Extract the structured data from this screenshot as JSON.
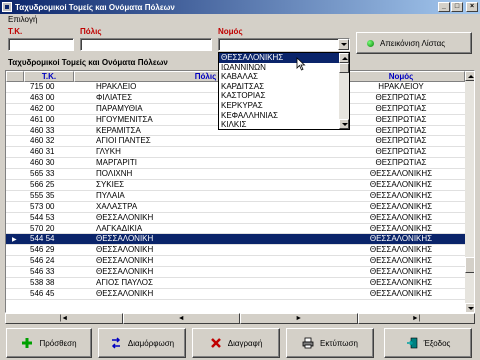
{
  "window": {
    "title": "Ταχυδρομικοί Τομείς και Ονόματα Πόλεων",
    "minimize": "_",
    "maximize": "□",
    "close": "×"
  },
  "selection": {
    "group_label": "Επιλογή",
    "tk_label": "Τ.Κ.",
    "city_label": "Πόλις",
    "nomos_label": "Νομός",
    "tk_value": "",
    "city_value": "",
    "nomos_value": "",
    "show_all_label": "Απεικόνιση Λίστας"
  },
  "dropdown": {
    "options": [
      "ΘΕΣΣΑΛΟΝΙΚΗΣ",
      "ΙΩΑΝΝΙΝΩΝ",
      "ΚΑΒΑΛΑΣ",
      "ΚΑΡΔΙΤΣΑΣ",
      "ΚΑΣΤΟΡΙΑΣ",
      "ΚΕΡΚΥΡΑΣ",
      "ΚΕΦΑΛΛΗΝΙΑΣ",
      "ΚΙΛΚΙΣ"
    ],
    "highlighted": 0
  },
  "grid": {
    "title": "Ταχυδρομικοί Τομείς και Ονόματα Πόλεων",
    "headers": {
      "tk": "Τ.Κ.",
      "city": "Πόλις",
      "nomos": "Νομός"
    },
    "rows": [
      {
        "tk": "715 00",
        "city": "ΗΡΑΚΛΕΙΟ",
        "nomos": "ΗΡΑΚΛΕΙΟΥ"
      },
      {
        "tk": "463 00",
        "city": "ΦΙΛΙΑΤΕΣ",
        "nomos": "ΘΕΣΠΡΩΤΙΑΣ"
      },
      {
        "tk": "462 00",
        "city": "ΠΑΡΑΜΥΘΙΑ",
        "nomos": "ΘΕΣΠΡΩΤΙΑΣ"
      },
      {
        "tk": "461 00",
        "city": "ΗΓΟΥΜΕΝΙΤΣΑ",
        "nomos": "ΘΕΣΠΡΩΤΙΑΣ"
      },
      {
        "tk": "460 33",
        "city": "ΚΕΡΑΜΙΤΣΑ",
        "nomos": "ΘΕΣΠΡΩΤΙΑΣ"
      },
      {
        "tk": "460 32",
        "city": "ΑΓΙΟΙ ΠΑΝΤΕΣ",
        "nomos": "ΘΕΣΠΡΩΤΙΑΣ"
      },
      {
        "tk": "460 31",
        "city": "ΓΛΥΚΗ",
        "nomos": "ΘΕΣΠΡΩΤΙΑΣ"
      },
      {
        "tk": "460 30",
        "city": "ΜΑΡΓΑΡΙΤΙ",
        "nomos": "ΘΕΣΠΡΩΤΙΑΣ"
      },
      {
        "tk": "565 33",
        "city": "ΠΟΛΙΧΝΗ",
        "nomos": "ΘΕΣΣΑΛΟΝΙΚΗΣ"
      },
      {
        "tk": "566 25",
        "city": "ΣΥΚΙΕΣ",
        "nomos": "ΘΕΣΣΑΛΟΝΙΚΗΣ"
      },
      {
        "tk": "555 35",
        "city": "ΠΥΛΑΙΑ",
        "nomos": "ΘΕΣΣΑΛΟΝΙΚΗΣ"
      },
      {
        "tk": "573 00",
        "city": "ΧΑΛΑΣΤΡΑ",
        "nomos": "ΘΕΣΣΑΛΟΝΙΚΗΣ"
      },
      {
        "tk": "544 53",
        "city": "ΘΕΣΣΑΛΟΝΙΚΗ",
        "nomos": "ΘΕΣΣΑΛΟΝΙΚΗΣ"
      },
      {
        "tk": "570 20",
        "city": "ΛΑΓΚΑΔΙΚΙΑ",
        "nomos": "ΘΕΣΣΑΛΟΝΙΚΗΣ"
      },
      {
        "tk": "544 54",
        "city": "ΘΕΣΣΑΛΟΝΙΚΗ",
        "nomos": "ΘΕΣΣΑΛΟΝΙΚΗΣ"
      },
      {
        "tk": "546 29",
        "city": "ΘΕΣΣΑΛΟΝΙΚΗ",
        "nomos": "ΘΕΣΣΑΛΟΝΙΚΗΣ"
      },
      {
        "tk": "546 24",
        "city": "ΘΕΣΣΑΛΟΝΙΚΗ",
        "nomos": "ΘΕΣΣΑΛΟΝΙΚΗΣ"
      },
      {
        "tk": "546 33",
        "city": "ΘΕΣΣΑΛΟΝΙΚΗ",
        "nomos": "ΘΕΣΣΑΛΟΝΙΚΗΣ"
      },
      {
        "tk": "538 38",
        "city": "ΑΓΙΟΣ ΠΑΥΛΟΣ",
        "nomos": "ΘΕΣΣΑΛΟΝΙΚΗΣ"
      },
      {
        "tk": "546 45",
        "city": "ΘΕΣΣΑΛΟΝΙΚΗ",
        "nomos": "ΘΕΣΣΑΛΟΝΙΚΗΣ"
      }
    ],
    "selected_row": 14
  },
  "navigation": {
    "first": "|◄",
    "prev": "◄",
    "next": "►",
    "last": "►|"
  },
  "actions": {
    "add": "Πρόσθεση",
    "edit": "Διαμόρφωση",
    "delete": "Διαγραφή",
    "print": "Εκτύπωση",
    "exit": "Έξοδος"
  },
  "colors": {
    "selection": "#0a246a",
    "header_text": "#0000c0",
    "label_red": "#c00000",
    "face": "#d4d0c8"
  },
  "icons": {
    "add": "plus-icon",
    "edit": "arrows-icon",
    "delete": "x-icon",
    "print": "printer-icon",
    "exit": "exit-door-icon"
  }
}
